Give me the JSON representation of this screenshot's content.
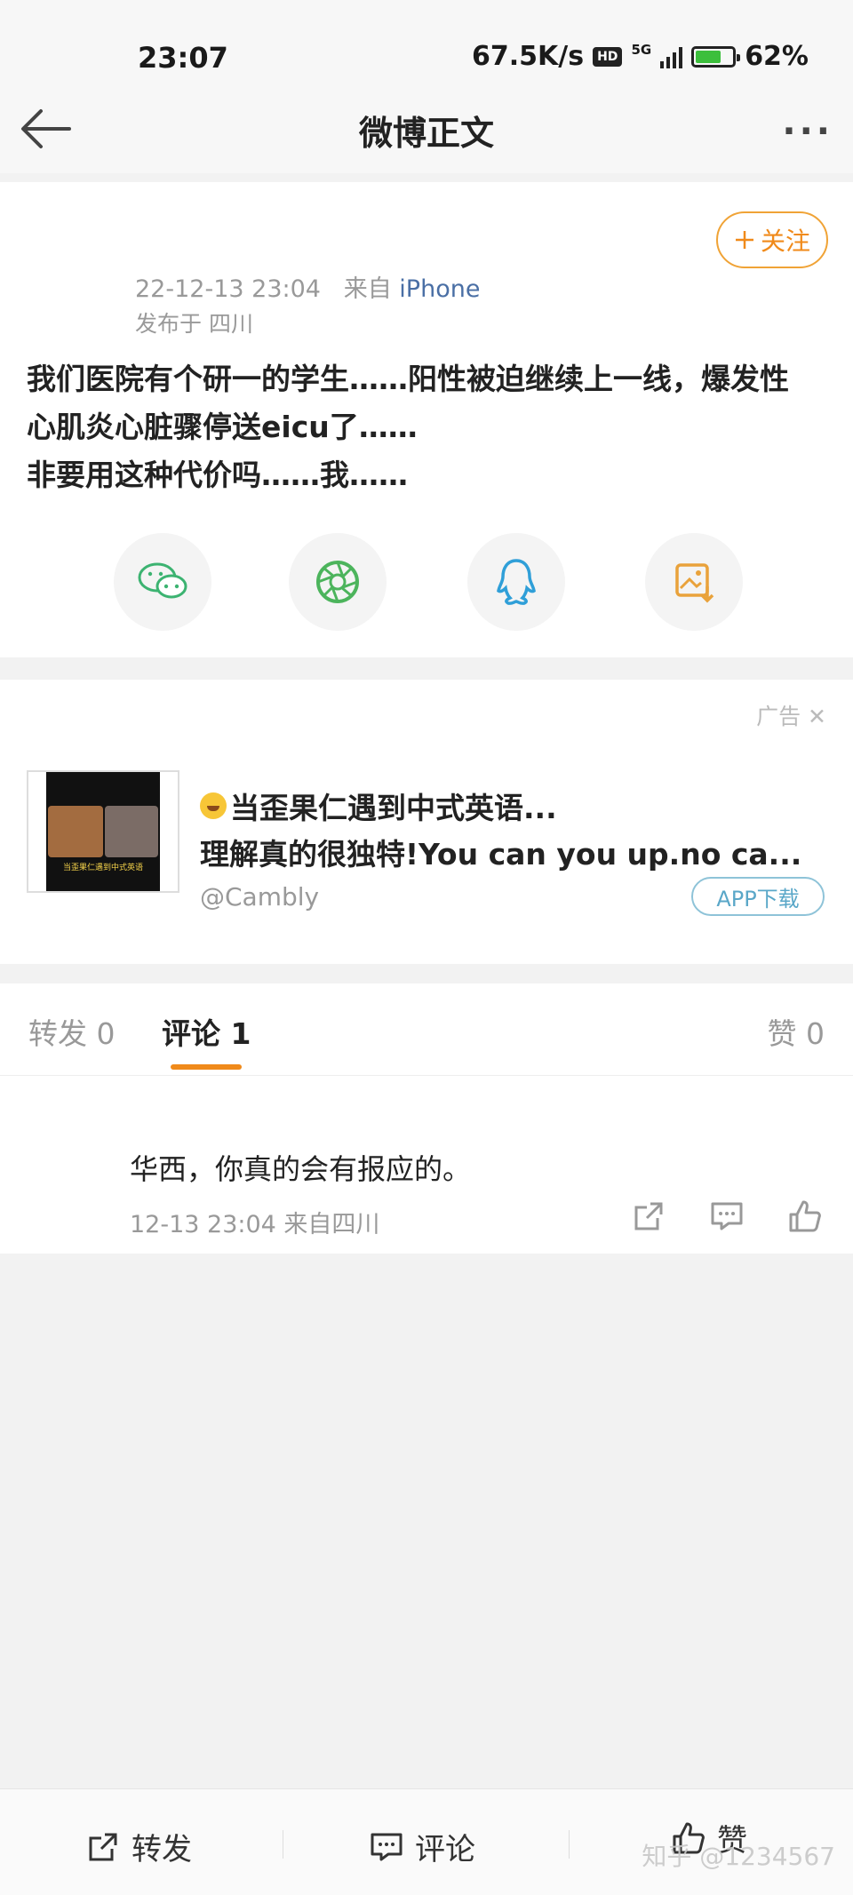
{
  "status_bar": {
    "time": "23:07",
    "net_speed": "67.5K/s",
    "hd": "HD",
    "network": "5G",
    "battery": "62%"
  },
  "nav": {
    "title": "微博正文",
    "more": "···"
  },
  "post": {
    "follow_label": "关注",
    "time": "22-12-13 23:04",
    "source_prefix": "来自",
    "source": "iPhone",
    "location": "发布于 四川",
    "text_lines": [
      "我们医院有个研一的学生……阳性被迫继续上一线，爆发性",
      "心肌炎心脏骤停送eicu了……",
      "非要用这种代价吗……我……"
    ],
    "share_icons": [
      "wechat-icon",
      "moments-icon",
      "qq-icon",
      "save-image-icon"
    ]
  },
  "ad": {
    "label": "广告",
    "close": "✕",
    "line1": "当歪果仁遇到中式英语...",
    "line2": "理解真的很独特!You can you up.no ca...",
    "handle": "@Cambly",
    "button": "APP下载",
    "thumb_caption": "当歪果仁遇到中式英语"
  },
  "tabs": {
    "repost": "转发 0",
    "comment": "评论 1",
    "like": "赞 0"
  },
  "comment": {
    "text": "华西，你真的会有报应的。",
    "meta": "12-13 23:04  来自四川"
  },
  "bottom_bar": {
    "repost": "转发",
    "comment": "评论",
    "like": "赞"
  },
  "watermark": "知乎 @1234567"
}
